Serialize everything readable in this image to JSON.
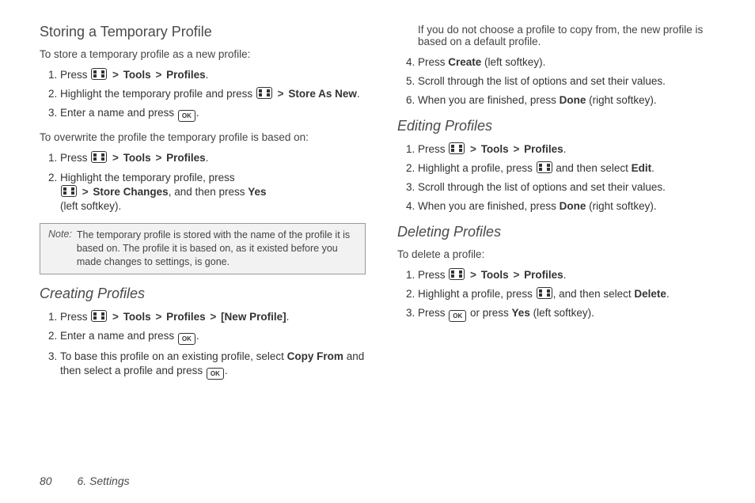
{
  "footer": {
    "page_number": "80",
    "chapter": "6. Settings"
  },
  "icons": {
    "menu": "menu-icon",
    "ok_text": "OK"
  },
  "sep": ">",
  "col1": {
    "h_storing": "Storing a Temporary Profile",
    "storing_intro": "To store a temporary profile as a new profile:",
    "storing_steps": {
      "s1_a": "Press ",
      "s1_b": "Tools",
      "s1_c": "Profiles",
      "s1_d": ".",
      "s2_a": "Highlight the temporary profile and press ",
      "s2_b": "Store As New",
      "s2_c": ".",
      "s3_a": "Enter a name and press ",
      "s3_b": "."
    },
    "overwrite_intro": "To overwrite the profile the temporary profile is based on:",
    "overwrite_steps": {
      "s1_a": "Press ",
      "s1_b": "Tools",
      "s1_c": "Profiles",
      "s1_d": ".",
      "s2_a": "Highlight the temporary profile, press ",
      "s2_b": "Store Changes",
      "s2_c": ", and then press ",
      "s2_d": "Yes",
      "s2_e": " (left softkey)."
    },
    "note_label": "Note:",
    "note_body": "The temporary profile is stored with the name of the profile it is based on. The profile it is based on, as it existed before you made changes to settings, is gone.",
    "h_creating": "Creating Profiles",
    "creating_steps": {
      "s1_a": "Press ",
      "s1_b": "Tools",
      "s1_c": "Profiles",
      "s1_d": "[New Profile]",
      "s1_e": ".",
      "s2_a": "Enter a name and press ",
      "s2_b": ".",
      "s3_a": "To base this profile on an existing profile, select ",
      "s3_b": "Copy From",
      "s3_c": " and then select a profile and press ",
      "s3_d": "."
    }
  },
  "col2": {
    "cont_intro": "If you do not choose a profile to copy from, the new profile is based on a default profile.",
    "cont_steps": {
      "s4_a": "Press ",
      "s4_b": "Create",
      "s4_c": " (left softkey).",
      "s5": "Scroll through the list of options and set their values.",
      "s6_a": "When you are finished, press ",
      "s6_b": "Done",
      "s6_c": " (right softkey)."
    },
    "h_editing": "Editing Profiles",
    "editing_steps": {
      "s1_a": "Press ",
      "s1_b": "Tools",
      "s1_c": "Profiles",
      "s1_d": ".",
      "s2_a": "Highlight a profile, press ",
      "s2_b": " and then select ",
      "s2_c": "Edit",
      "s2_d": ".",
      "s3": "Scroll through the list of options and set their values.",
      "s4_a": "When you are finished, press ",
      "s4_b": "Done",
      "s4_c": " (right softkey)."
    },
    "h_deleting": "Deleting Profiles",
    "deleting_intro": "To delete a profile:",
    "deleting_steps": {
      "s1_a": "Press ",
      "s1_b": "Tools",
      "s1_c": "Profiles",
      "s1_d": ".",
      "s2_a": "Highlight a profile, press ",
      "s2_b": ", and then select ",
      "s2_c": "Delete",
      "s2_d": ".",
      "s3_a": "Press ",
      "s3_b": " or press ",
      "s3_c": "Yes",
      "s3_d": " (left softkey)."
    }
  }
}
